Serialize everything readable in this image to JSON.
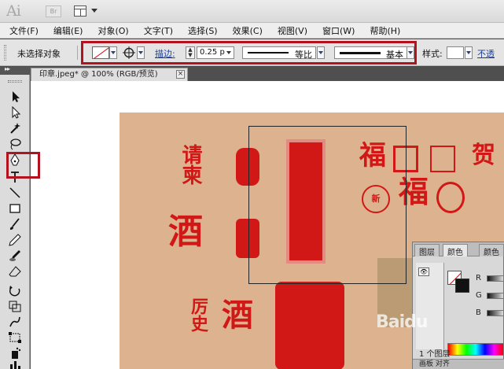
{
  "app": {
    "logo": "Ai",
    "bridge_label": "Br"
  },
  "menu": [
    "文件(F)",
    "编辑(E)",
    "对象(O)",
    "文字(T)",
    "选择(S)",
    "效果(C)",
    "视图(V)",
    "窗口(W)",
    "帮助(H)"
  ],
  "control": {
    "no_selection": "未选择对象",
    "stroke_label": "描边:",
    "stroke_weight": "0.25 p",
    "profile_label": "等比",
    "brush_label": "基本",
    "style_label": "样式:",
    "opacity_label": "不透"
  },
  "document": {
    "tab_title": "印章.jpeg* @ 100% (RGB/预览)",
    "close_glyph": "×"
  },
  "seals": [
    {
      "text": "请柬"
    },
    {
      "text": "酒"
    },
    {
      "text": "厉史"
    },
    {
      "text": "福"
    },
    {
      "text": "酒"
    },
    {
      "text": "贺"
    },
    {
      "text": "福"
    },
    {
      "text": "新"
    }
  ],
  "panel": {
    "tabs": [
      "图层",
      "颜色",
      "颜色"
    ],
    "channels": [
      "R",
      "G",
      "B"
    ],
    "layers_count": "1 个图层",
    "bottom_tabs": "画板  对齐"
  },
  "watermark": "Baidu",
  "colors": {
    "highlight": "#b3131f",
    "seal_red": "#d21717",
    "artboard_bg": "#ddb38f"
  }
}
